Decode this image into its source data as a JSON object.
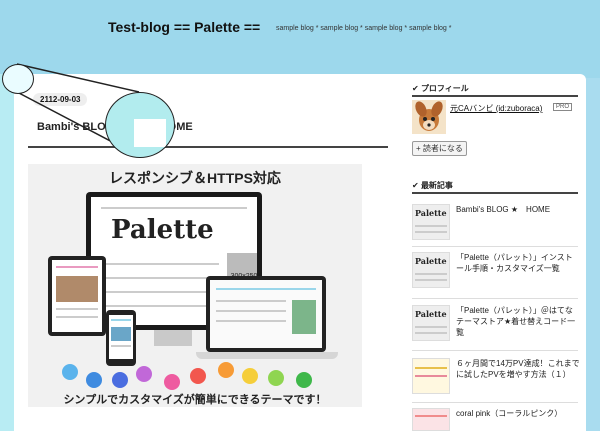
{
  "header": {
    "title": "Test-blog == Palette ==",
    "description": "sample blog * sample blog * sample blog * sample blog *"
  },
  "post": {
    "date": "2112-09-03",
    "title_part1": "Bambi's BLO",
    "title_part2": "OME"
  },
  "hero": {
    "top_text": "レスポンシブ＆HTTPS対応",
    "bottom_text": "シンプルでカスタマイズが簡単にできるテーマです！",
    "monitor_word": "Palette",
    "ad_label": "300x250",
    "dot_colors": [
      "#5ab3ec",
      "#3f8be0",
      "#4a6de0",
      "#c168d8",
      "#ee5ba0",
      "#f2574e",
      "#f79b36",
      "#f5ce3a",
      "#8fd551",
      "#3fb84a"
    ]
  },
  "sidebar": {
    "profile_heading": "プロフィール",
    "profile_name": "元CAバンビ (id:zuboraca)",
    "pro_badge": "PRO",
    "reader_button": "+ 読者になる",
    "recent_heading": "最新記事",
    "thumb_word": "Palette",
    "articles": [
      {
        "title": "Bambi's BLOG ★　HOME"
      },
      {
        "title": "「Palette（パレット）」インストール手順・カスタマイズ一覧"
      },
      {
        "title": "「Palette（パレット）」＠はてなテーマストア★着せ替えコード一覧"
      },
      {
        "title": "６ヶ月間で14万PV達成！これまでに試したPVを増やす方法（１）"
      },
      {
        "title": "coral pink（コーラルピンク）"
      }
    ]
  },
  "colors": {
    "header_bg": "#9dd8ec",
    "accent_border": "#b8ecf3"
  }
}
